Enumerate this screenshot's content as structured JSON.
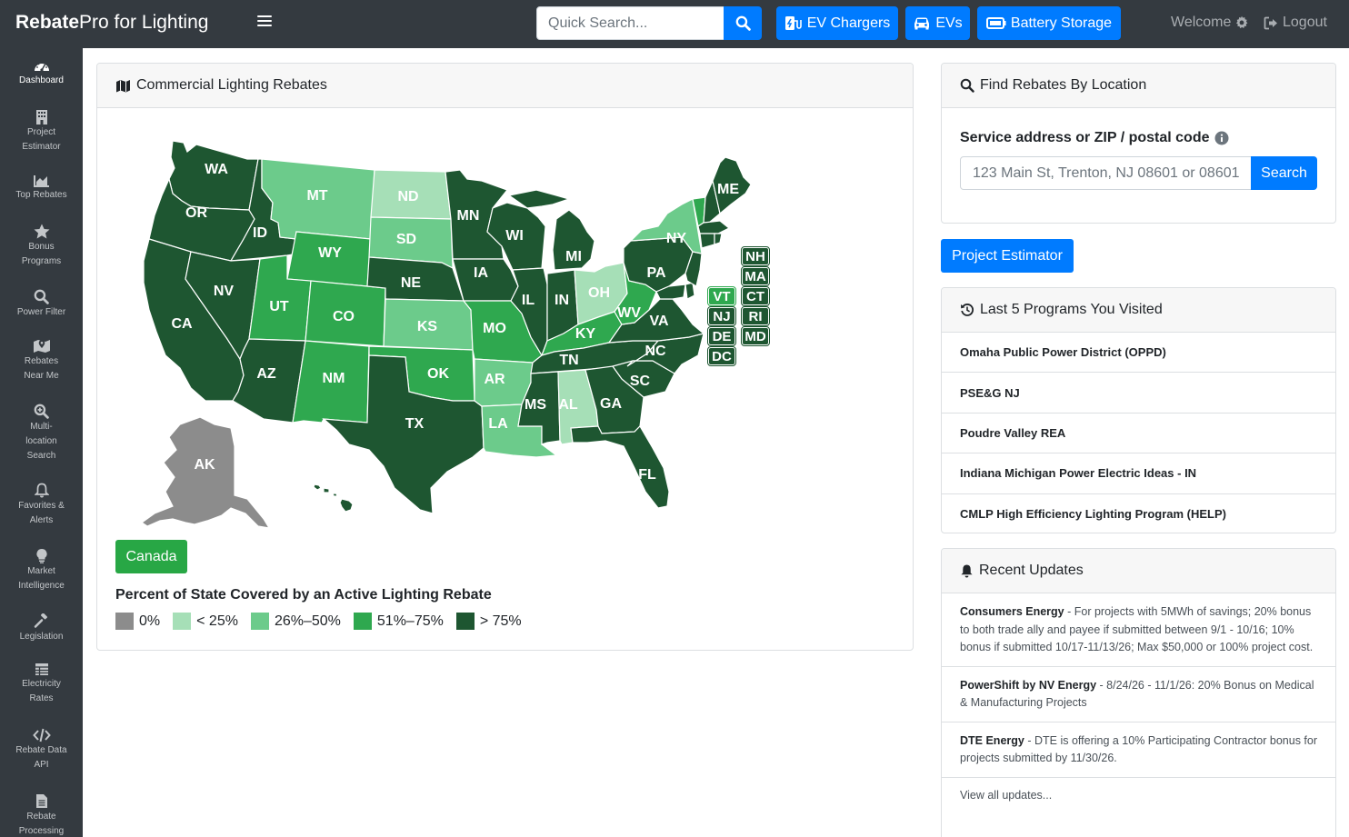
{
  "navbar": {
    "brand_bold": "Rebate",
    "brand_rest": "Pro for Lighting",
    "search_placeholder": "Quick Search...",
    "buttons": [
      {
        "label": "EV Chargers",
        "icon": "ev-charger-icon"
      },
      {
        "label": "EVs",
        "icon": "car-icon"
      },
      {
        "label": "Battery Storage",
        "icon": "battery-icon"
      }
    ],
    "welcome": "Welcome",
    "logout": "Logout"
  },
  "sidebar": {
    "items": [
      {
        "label": "Dashboard",
        "icon": "dashboard-gauge-icon",
        "active": true
      },
      {
        "label": "Project Estimator",
        "icon": "building-icon"
      },
      {
        "label": "Top Rebates",
        "icon": "area-chart-icon"
      },
      {
        "label": "Bonus Programs",
        "icon": "star-icon"
      },
      {
        "label": "Power Filter",
        "icon": "search-icon"
      },
      {
        "label": "Rebates Near Me",
        "icon": "map-marker-icon"
      },
      {
        "label": "Multi-location Search",
        "icon": "search-plus-icon"
      },
      {
        "label": "Favorites & Alerts",
        "icon": "bell-icon"
      },
      {
        "label": "Market Intelligence",
        "icon": "lightbulb-icon"
      },
      {
        "label": "Legislation",
        "icon": "gavel-icon"
      },
      {
        "label": "Electricity Rates",
        "icon": "table-icon"
      },
      {
        "label": "Rebate Data API",
        "icon": "code-icon"
      },
      {
        "label": "Rebate Processing",
        "icon": "document-icon"
      }
    ]
  },
  "map_card": {
    "title": "Commercial Lighting Rebates",
    "canada_button": "Canada",
    "legend_title": "Percent of State Covered by an Active Lighting Rebate",
    "legend": [
      {
        "label": "0%",
        "color": "#8c8c8c"
      },
      {
        "label": "< 25%",
        "color": "#a6dfb7"
      },
      {
        "label": "26%–50%",
        "color": "#6ccb8b"
      },
      {
        "label": "51%–75%",
        "color": "#2fa84f"
      },
      {
        "label": "> 75%",
        "color": "#1e5631"
      }
    ],
    "states": {
      "WA": "> 75%",
      "OR": "> 75%",
      "CA": "> 75%",
      "ID": "> 75%",
      "NV": "> 75%",
      "MT": "26%–50%",
      "WY": "51%–75%",
      "UT": "51%–75%",
      "AZ": "> 75%",
      "CO": "51%–75%",
      "NM": "51%–75%",
      "ND": "< 25%",
      "SD": "26%–50%",
      "NE": "> 75%",
      "KS": "26%–50%",
      "OK": "51%–75%",
      "TX": "> 75%",
      "MN": "> 75%",
      "IA": "> 75%",
      "MO": "51%–75%",
      "AR": "26%–50%",
      "LA": "26%–50%",
      "WI": "> 75%",
      "IL": "> 75%",
      "MI": "> 75%",
      "IN": "> 75%",
      "OH": "< 25%",
      "KY": "51%–75%",
      "TN": "> 75%",
      "MS": "> 75%",
      "AL": "< 25%",
      "GA": "> 75%",
      "FL": "> 75%",
      "SC": "> 75%",
      "NC": "> 75%",
      "VA": "> 75%",
      "WV": "51%–75%",
      "PA": "> 75%",
      "NY": "26%–50%",
      "ME": "> 75%",
      "AK": "0%",
      "HI": "> 75%",
      "NH": "> 75%",
      "MA": "> 75%",
      "VT": "51%–75%",
      "CT": "> 75%",
      "NJ": "> 75%",
      "RI": "> 75%",
      "DE": "> 75%",
      "MD": "> 75%",
      "DC": "> 75%"
    }
  },
  "location_card": {
    "title": "Find Rebates By Location",
    "field_label": "Service address or ZIP / postal code",
    "placeholder": "123 Main St, Trenton, NJ 08601 or 08601",
    "button": "Search"
  },
  "project_estimator_button": "Project Estimator",
  "recent_programs": {
    "title": "Last 5 Programs You Visited",
    "items": [
      "Omaha Public Power District (OPPD)",
      "PSE&G NJ",
      "Poudre Valley REA",
      "Indiana Michigan Power Electric Ideas - IN",
      "CMLP High Efficiency Lighting Program (HELP)"
    ]
  },
  "recent_updates": {
    "title": "Recent Updates",
    "items": [
      {
        "source": "Consumers Energy",
        "text": " - For projects with 5MWh of savings; 20% bonus to both trade ally and payee if submitted between 9/1 - 10/16; 10% bonus if submitted 10/17-11/13/26; Max $50,000 or 100% project cost."
      },
      {
        "source": "PowerShift by NV Energy",
        "text": " - 8/24/26 - 11/1/26: 20% Bonus on Medical & Manufacturing Projects"
      },
      {
        "source": "DTE Energy",
        "text": " - DTE is offering a 10% Participating Contractor bonus for projects submitted by 11/30/26."
      }
    ],
    "view_all": "View all updates..."
  }
}
